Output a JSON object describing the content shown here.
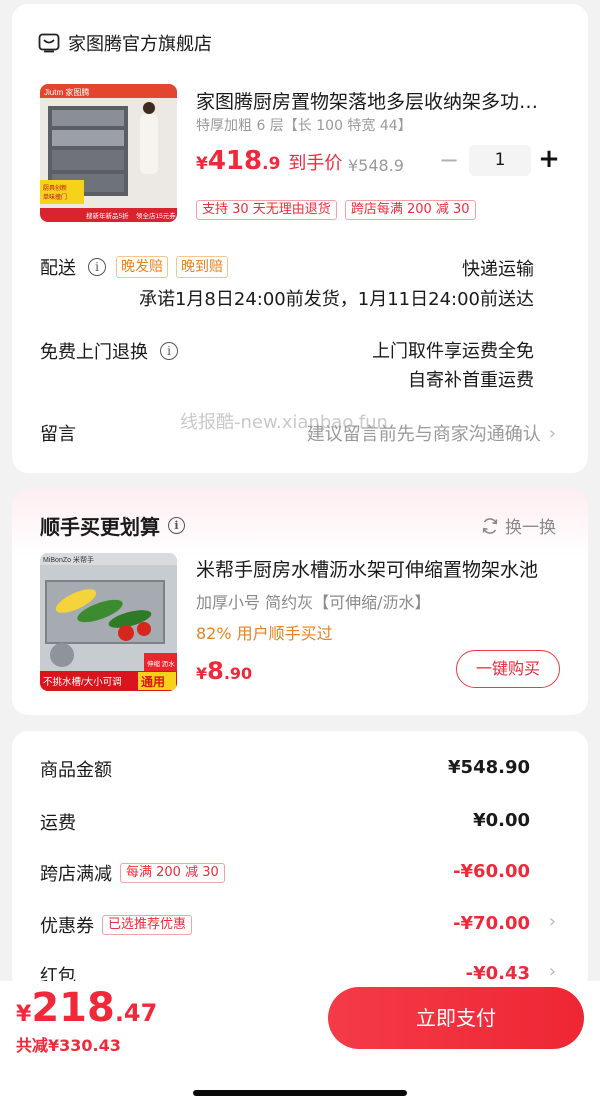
{
  "store": {
    "name": "家图腾官方旗舰店"
  },
  "product": {
    "title": "家图腾厨房置物架落地多层收纳架多功能储物柜",
    "spec": "特厚加粗 6 层【长 100 特宽 44】",
    "price_yen": "¥",
    "price_int": "418",
    "price_dec": ".9",
    "price_label": "到手价",
    "orig_price": "¥548.9",
    "quantity": "1",
    "tags": [
      "支持 30 天无理由退货",
      "跨店每满 200 减 30"
    ],
    "image_texts": {
      "logo": "Jiutm 家图腾",
      "badge1": "厨具创新",
      "badge2": "单味撞门",
      "strip1": "搜新年新品5折",
      "strip2": "领全店15元券"
    }
  },
  "delivery": {
    "label": "配送",
    "tags": [
      "晚发赔",
      "晚到赔"
    ],
    "method": "快递运输",
    "promise": "承诺1月8日24:00前发货，1月11日24:00前送达"
  },
  "return_service": {
    "label": "免费上门退换",
    "line1": "上门取件享运费全免",
    "line2": "自寄补首重运费"
  },
  "message": {
    "label": "留言",
    "placeholder": "建议留言前先与商家沟通确认"
  },
  "watermark": "线报酷-new.xianbao.fun",
  "addon": {
    "section_title": "顺手买更划算",
    "swap_label": "换一换",
    "title": "米帮手厨房水槽沥水架可伸缩置物架水池",
    "spec": "加厚小号  简约灰【可伸缩/沥水】",
    "buyers": "82% 用户顺手买过",
    "price_yen": "¥",
    "price_int": "8",
    "price_dec": ".90",
    "buy_label": "一键购买",
    "image_texts": {
      "brand": "MiBonZo 米帮手",
      "bottom": "不挑水槽/大小可调",
      "tag": "通用",
      "side": "伸缩 沥水"
    }
  },
  "summary": {
    "rows": [
      {
        "label": "商品金额",
        "value": "¥548.90"
      },
      {
        "label": "运费",
        "value": "¥0.00"
      },
      {
        "label": "跨店满减",
        "tag": "每满 200 减 30",
        "value": "-¥60.00"
      },
      {
        "label": "优惠券",
        "tag": "已选推荐优惠",
        "value": "-¥70.00"
      },
      {
        "label": "红包",
        "value": "-¥0.43"
      }
    ]
  },
  "footer": {
    "total_yen": "¥",
    "total_int": "218",
    "total_dec": ".47",
    "saved": "共减¥330.43",
    "pay_label": "立即支付"
  },
  "colors": {
    "accent": "#f0293a",
    "orange": "#e8821e",
    "gray": "#9a9a9a"
  }
}
